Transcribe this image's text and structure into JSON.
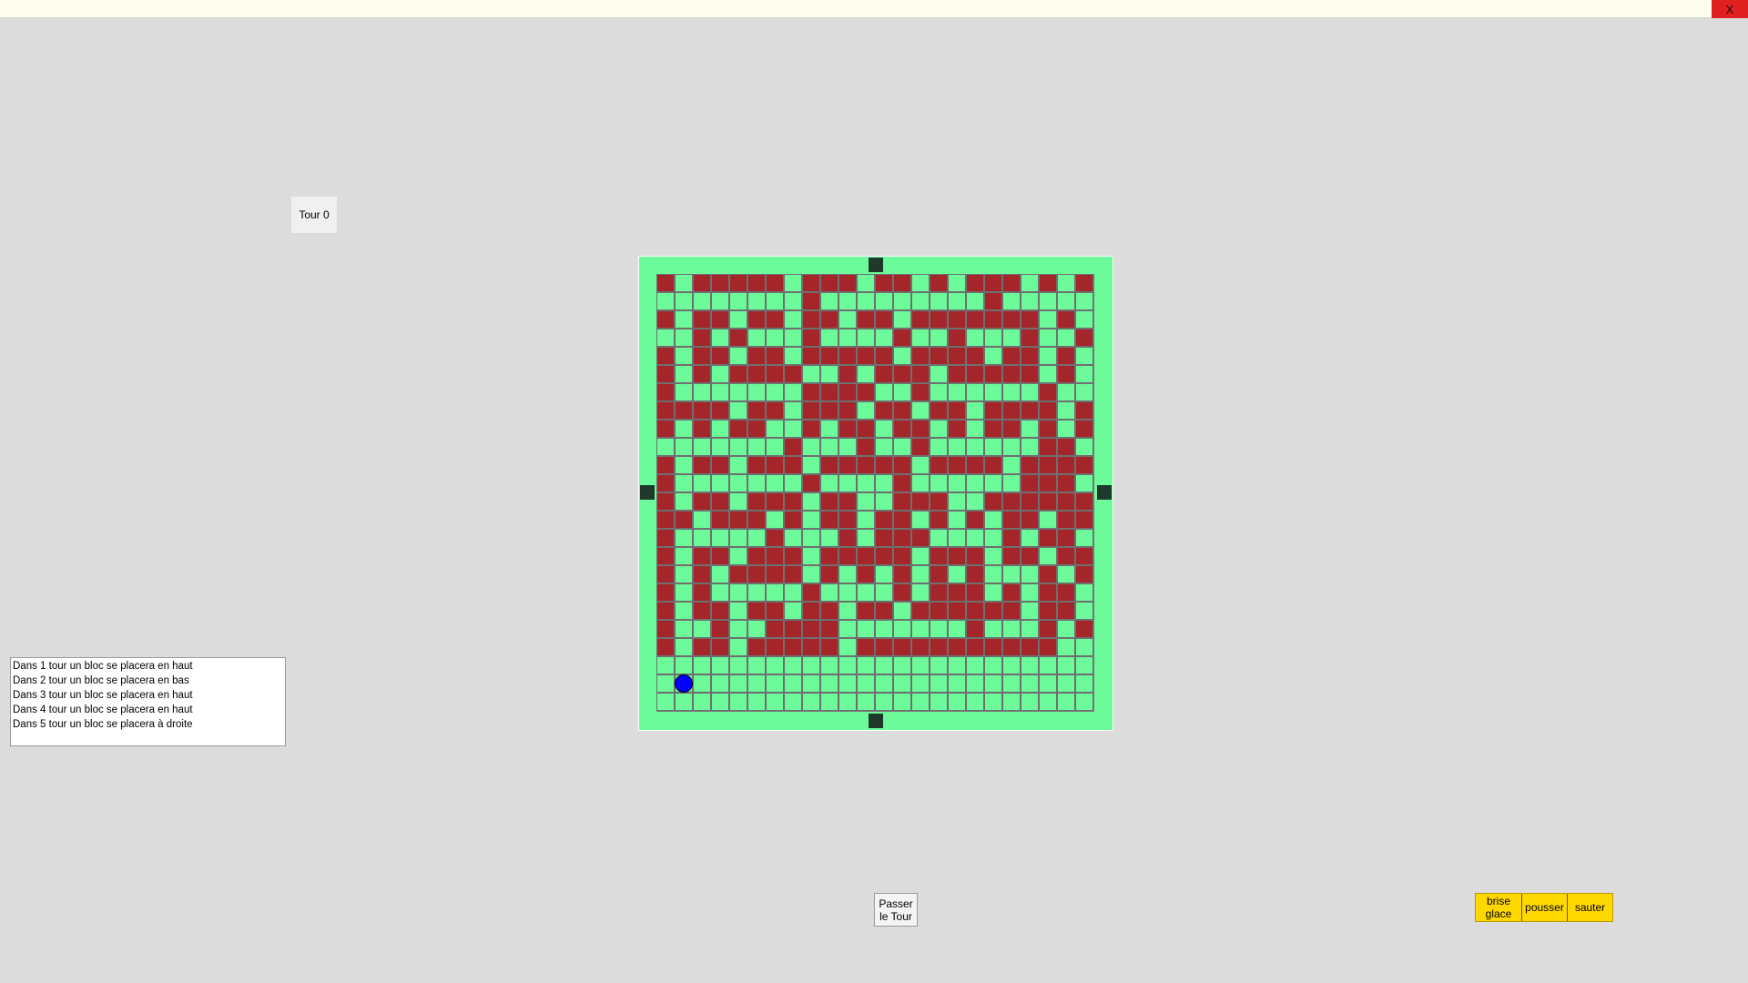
{
  "window": {
    "close_label": "X"
  },
  "turn": {
    "label": "Tour 0"
  },
  "board": {
    "size": 24,
    "colors": {
      "ice": "#6cfa9a",
      "wall": "#a4262a",
      "exit": "#1f3a2c",
      "player": "#0000ff"
    },
    "legend": {
      "#": "wall",
      ".": "ice"
    },
    "rows": [
      "#.#####.###.##.#.###.#.#",
      "........#.........#.....",
      "#.##.##.##.##.#######.#.",
      "..#.#...#....#..#...#..#",
      "#.##.##.#####.####.##.#.",
      "#.#.####..#.###.#####.#.",
      "#.......####..#......#..",
      "####.##.###.##.##.####.#",
      "#.#.##..#.##.##.#.##.#.#",
      ".......#...#..#......##.",
      "#.##.###.#####.####.####",
      "#.......#....#......###.",
      "#.##.###.##..###..######",
      "##.###.#.##.##.#.#.##.##",
      "#.....#...#.###....#.##.",
      "#.##.###.#####.###.##.##",
      "#.#.####.#.#.#.#.#...#.#",
      "#.#.....#....#.###.#.##.",
      "#.##.##.##.##.######.##.",
      "#..#..####.......#...#.#",
      "#.##.#####.###########.."
    ],
    "exits": [
      "top",
      "left",
      "right",
      "bottom"
    ],
    "player": {
      "row": 22,
      "col": 1
    }
  },
  "forecast": [
    "Dans 1 tour un bloc se placera en haut",
    "Dans 2 tour un bloc se placera en bas",
    "Dans 3 tour un bloc se placera en haut",
    "Dans 4 tour un bloc se placera en haut",
    "Dans 5 tour un bloc se placera à droite"
  ],
  "pass_button": {
    "line1": "Passer",
    "line2": "le Tour"
  },
  "actions": [
    {
      "line1": "brise",
      "line2": "glace"
    },
    {
      "line1": "pousser",
      "line2": ""
    },
    {
      "line1": "sauter",
      "line2": ""
    }
  ]
}
